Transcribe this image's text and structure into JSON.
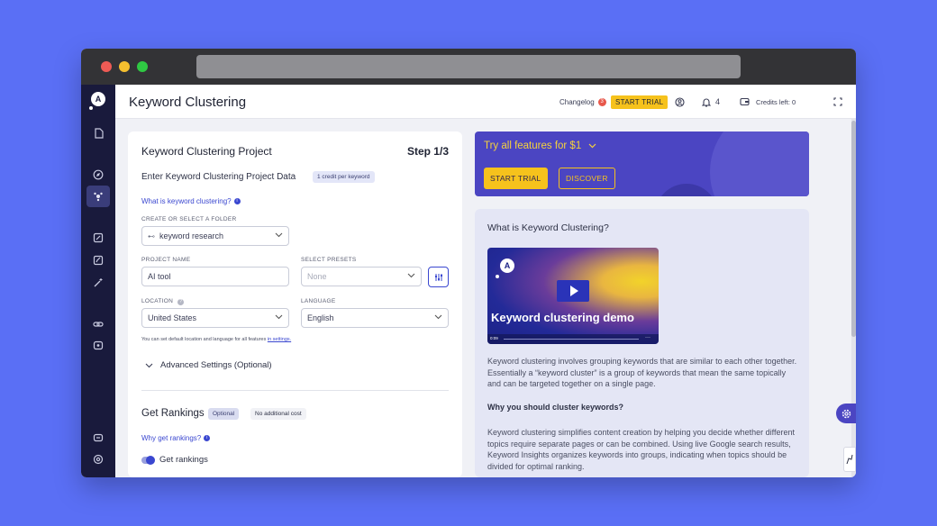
{
  "page": {
    "title": "Keyword Clustering"
  },
  "topbar": {
    "changelog_label": "Changelog",
    "changelog_count": "3",
    "start_trial_label": "START TRIAL",
    "notifications_count": "4",
    "credits_label": "Credits left: 0"
  },
  "project": {
    "title": "Keyword Clustering Project",
    "step": "Step 1/3",
    "subtitle": "Enter Keyword Clustering Project Data",
    "credit_badge": "1 credit per keyword",
    "what_is_link": "What is keyword clustering?",
    "folder_label": "CREATE OR SELECT A FOLDER",
    "folder_value": "keyword research",
    "project_name_label": "PROJECT NAME",
    "project_name_value": "AI tool",
    "presets_label": "SELECT PRESETS",
    "presets_placeholder": "None",
    "location_label": "LOCATION",
    "location_value": "United States",
    "language_label": "LANGUAGE",
    "language_value": "English",
    "defaults_note_prefix": "You can set default location and language for all features",
    "defaults_note_link": "in settings.",
    "advanced_settings": "Advanced Settings (Optional)",
    "rankings_title": "Get Rankings",
    "optional_badge": "Optional",
    "no_cost_badge": "No additional cost",
    "why_rankings_link": "Why get rankings?",
    "rankings_toggle_label": "Get rankings"
  },
  "promo": {
    "headline": "Try all features for $1",
    "start_trial_label": "START TRIAL",
    "discover_label": "DISCOVER"
  },
  "info": {
    "title": "What is Keyword Clustering?",
    "video_title": "Keyword clustering demo",
    "video_time": "0:09",
    "paragraph1": "Keyword clustering involves grouping keywords that are similar to each other together. Essentially a “keyword cluster” is a group of keywords that mean the same topically and can be targeted together on a single page.",
    "why_heading": "Why you should cluster keywords?",
    "paragraph2": "Keyword clustering simplifies content creation by helping you decide whether different topics require separate pages or can be combined. Using live Google search results, Keyword Insights organizes keywords into groups, indicating when topics should be divided for optimal ranking."
  },
  "colors": {
    "background": "#5a6ff5",
    "sidebar": "#191a3c",
    "accent_yellow": "#f6c21c",
    "accent_blue": "#3a47d0",
    "promo_bg": "#4b45c2"
  }
}
